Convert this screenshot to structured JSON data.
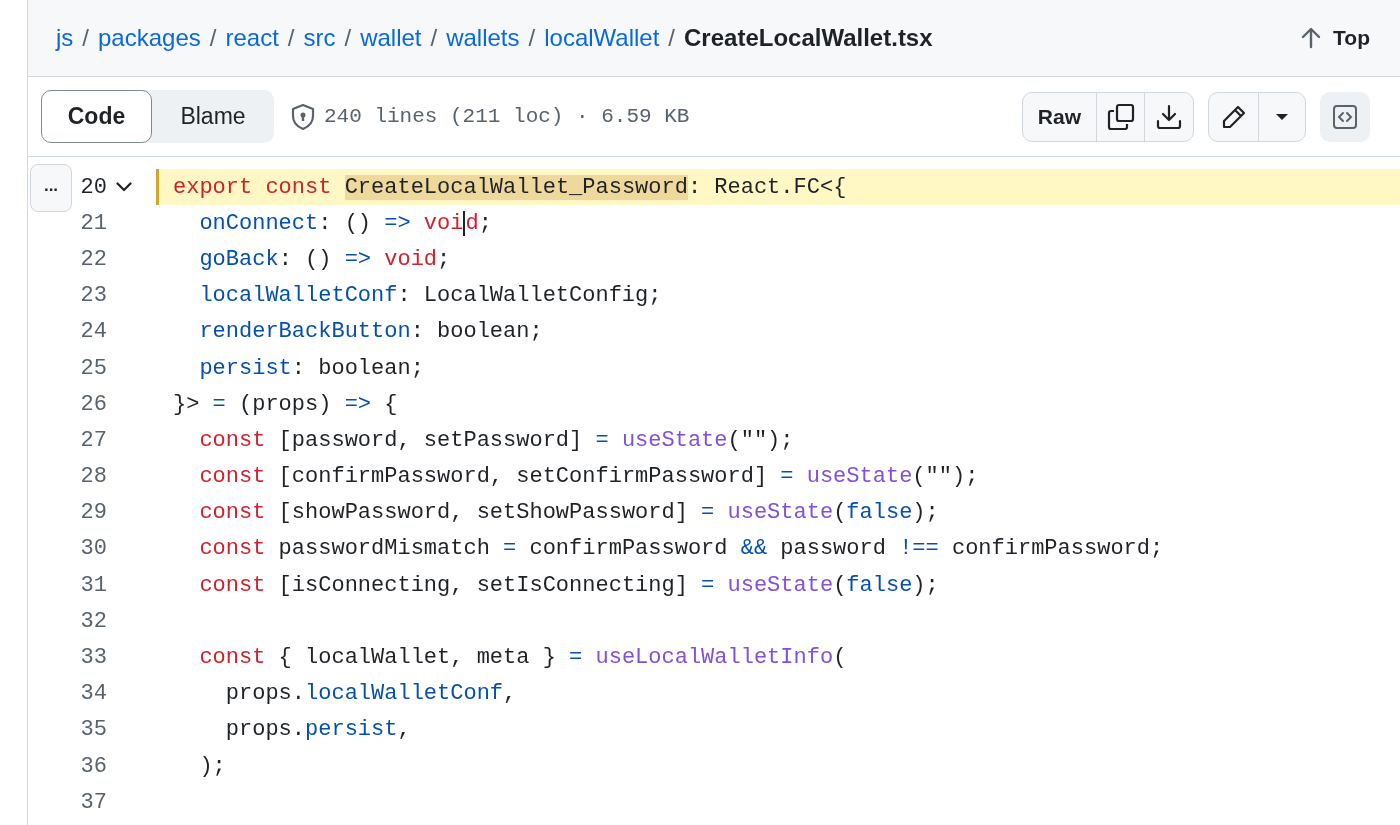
{
  "breadcrumb": {
    "links": [
      "js",
      "packages",
      "react",
      "src",
      "wallet",
      "wallets",
      "localWallet"
    ],
    "separator": "/",
    "current": "CreateLocalWallet.tsx"
  },
  "top_link": "Top",
  "view_tabs": [
    {
      "label": "Code",
      "selected": true
    },
    {
      "label": "Blame",
      "selected": false
    }
  ],
  "file_info": "240 lines (211 loc) · 6.59 KB",
  "raw_button": "Raw",
  "expand_button": "...",
  "lines": [
    {
      "number": "20",
      "selected": true,
      "foldable": true,
      "tokens": [
        {
          "text": "export const ",
          "kind": "keyword"
        },
        {
          "text": "CreateLocalWallet_Password",
          "kind": "match"
        },
        {
          "text": ": React.FC<{",
          "kind": "plain"
        }
      ]
    },
    {
      "number": "21",
      "selected": false,
      "tokens": [
        {
          "text": "  onConnect",
          "kind": "property"
        },
        {
          "text": ": () ",
          "kind": "plain"
        },
        {
          "text": "=>",
          "kind": "operator"
        },
        {
          "text": " voi",
          "kind": "keyword"
        },
        {
          "text": "d",
          "kind": "keyword",
          "caret": true
        },
        {
          "text": ";",
          "kind": "plain"
        }
      ]
    },
    {
      "number": "22",
      "selected": false,
      "tokens": [
        {
          "text": "  goBack",
          "kind": "property"
        },
        {
          "text": ": () ",
          "kind": "plain"
        },
        {
          "text": "=>",
          "kind": "operator"
        },
        {
          "text": " void",
          "kind": "keyword"
        },
        {
          "text": ";",
          "kind": "plain"
        }
      ]
    },
    {
      "number": "23",
      "selected": false,
      "tokens": [
        {
          "text": "  localWalletConf",
          "kind": "property"
        },
        {
          "text": ": LocalWalletConfig;",
          "kind": "plain"
        }
      ]
    },
    {
      "number": "24",
      "selected": false,
      "tokens": [
        {
          "text": "  renderBackButton",
          "kind": "property"
        },
        {
          "text": ": boolean;",
          "kind": "plain"
        }
      ]
    },
    {
      "number": "25",
      "selected": false,
      "tokens": [
        {
          "text": "  persist",
          "kind": "property"
        },
        {
          "text": ": boolean;",
          "kind": "plain"
        }
      ]
    },
    {
      "number": "26",
      "selected": false,
      "tokens": [
        {
          "text": "}> ",
          "kind": "plain"
        },
        {
          "text": "=",
          "kind": "operator"
        },
        {
          "text": " (props) ",
          "kind": "plain"
        },
        {
          "text": "=>",
          "kind": "operator"
        },
        {
          "text": " {",
          "kind": "plain"
        }
      ]
    },
    {
      "number": "27",
      "selected": false,
      "tokens": [
        {
          "text": "  const",
          "kind": "keyword"
        },
        {
          "text": " [password, setPassword] ",
          "kind": "plain"
        },
        {
          "text": "= ",
          "kind": "operator"
        },
        {
          "text": "useState",
          "kind": "function"
        },
        {
          "text": "(\"\");",
          "kind": "plain"
        }
      ]
    },
    {
      "number": "28",
      "selected": false,
      "tokens": [
        {
          "text": "  const",
          "kind": "keyword"
        },
        {
          "text": " [confirmPassword, setConfirmPassword] ",
          "kind": "plain"
        },
        {
          "text": "= ",
          "kind": "operator"
        },
        {
          "text": "useState",
          "kind": "function"
        },
        {
          "text": "(\"\");",
          "kind": "plain"
        }
      ]
    },
    {
      "number": "29",
      "selected": false,
      "tokens": [
        {
          "text": "  const",
          "kind": "keyword"
        },
        {
          "text": " [showPassword, setShowPassword] ",
          "kind": "plain"
        },
        {
          "text": "= ",
          "kind": "operator"
        },
        {
          "text": "useState",
          "kind": "function"
        },
        {
          "text": "(",
          "kind": "plain"
        },
        {
          "text": "false",
          "kind": "operator"
        },
        {
          "text": ");",
          "kind": "plain"
        }
      ]
    },
    {
      "number": "30",
      "selected": false,
      "tokens": [
        {
          "text": "  const",
          "kind": "keyword"
        },
        {
          "text": " passwordMismatch ",
          "kind": "plain"
        },
        {
          "text": "=",
          "kind": "operator"
        },
        {
          "text": " confirmPassword ",
          "kind": "plain"
        },
        {
          "text": "&&",
          "kind": "operator"
        },
        {
          "text": " password ",
          "kind": "plain"
        },
        {
          "text": "!==",
          "kind": "operator"
        },
        {
          "text": " confirmPassword;",
          "kind": "plain"
        }
      ]
    },
    {
      "number": "31",
      "selected": false,
      "tokens": [
        {
          "text": "  const",
          "kind": "keyword"
        },
        {
          "text": " [isConnecting, setIsConnecting] ",
          "kind": "plain"
        },
        {
          "text": "= ",
          "kind": "operator"
        },
        {
          "text": "useState",
          "kind": "function"
        },
        {
          "text": "(",
          "kind": "plain"
        },
        {
          "text": "false",
          "kind": "operator"
        },
        {
          "text": ");",
          "kind": "plain"
        }
      ]
    },
    {
      "number": "32",
      "selected": false
    },
    {
      "number": "33",
      "selected": false,
      "tokens": [
        {
          "text": "  const",
          "kind": "keyword"
        },
        {
          "text": " { localWallet, meta } ",
          "kind": "plain"
        },
        {
          "text": "= ",
          "kind": "operator"
        },
        {
          "text": "useLocalWalletInfo",
          "kind": "function"
        },
        {
          "text": "(",
          "kind": "plain"
        }
      ]
    },
    {
      "number": "34",
      "selected": false,
      "tokens": [
        {
          "text": "    props.",
          "kind": "plain"
        },
        {
          "text": "localWalletConf",
          "kind": "property"
        },
        {
          "text": ",",
          "kind": "plain"
        }
      ]
    },
    {
      "number": "35",
      "selected": false,
      "tokens": [
        {
          "text": "    props.",
          "kind": "plain"
        },
        {
          "text": "persist",
          "kind": "property"
        },
        {
          "text": ",",
          "kind": "plain"
        }
      ]
    },
    {
      "number": "36",
      "selected": false,
      "tokens": [
        {
          "text": "  );",
          "kind": "plain"
        }
      ]
    },
    {
      "number": "37",
      "selected": false
    }
  ]
}
